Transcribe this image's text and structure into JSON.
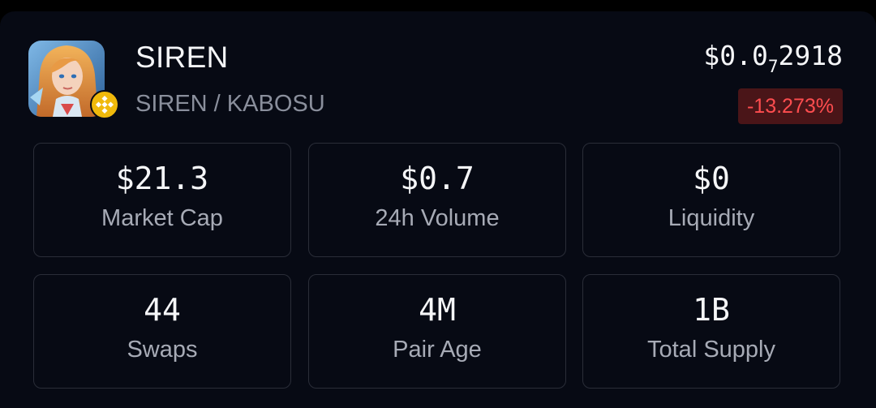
{
  "token": {
    "name": "SIREN",
    "pair": "SIREN / KABOSU",
    "avatar_icon": "siren-avatar",
    "chain_icon": "bnb-chain-icon",
    "price_prefix": "$0.0",
    "price_zero_count": "7",
    "price_digits": "2918",
    "change": "-13.273%"
  },
  "stats": [
    {
      "value": "$21.3",
      "label": "Market Cap"
    },
    {
      "value": "$0.7",
      "label": "24h Volume"
    },
    {
      "value": "$0",
      "label": "Liquidity"
    },
    {
      "value": "44",
      "label": "Swaps"
    },
    {
      "value": "4M",
      "label": "Pair Age"
    },
    {
      "value": "1B",
      "label": "Total Supply"
    }
  ],
  "colors": {
    "background": "#070a14",
    "card_border": "#2a2d38",
    "negative": "#ff4d4f",
    "negative_bg": "#4a1518",
    "bnb": "#f0b90b"
  }
}
